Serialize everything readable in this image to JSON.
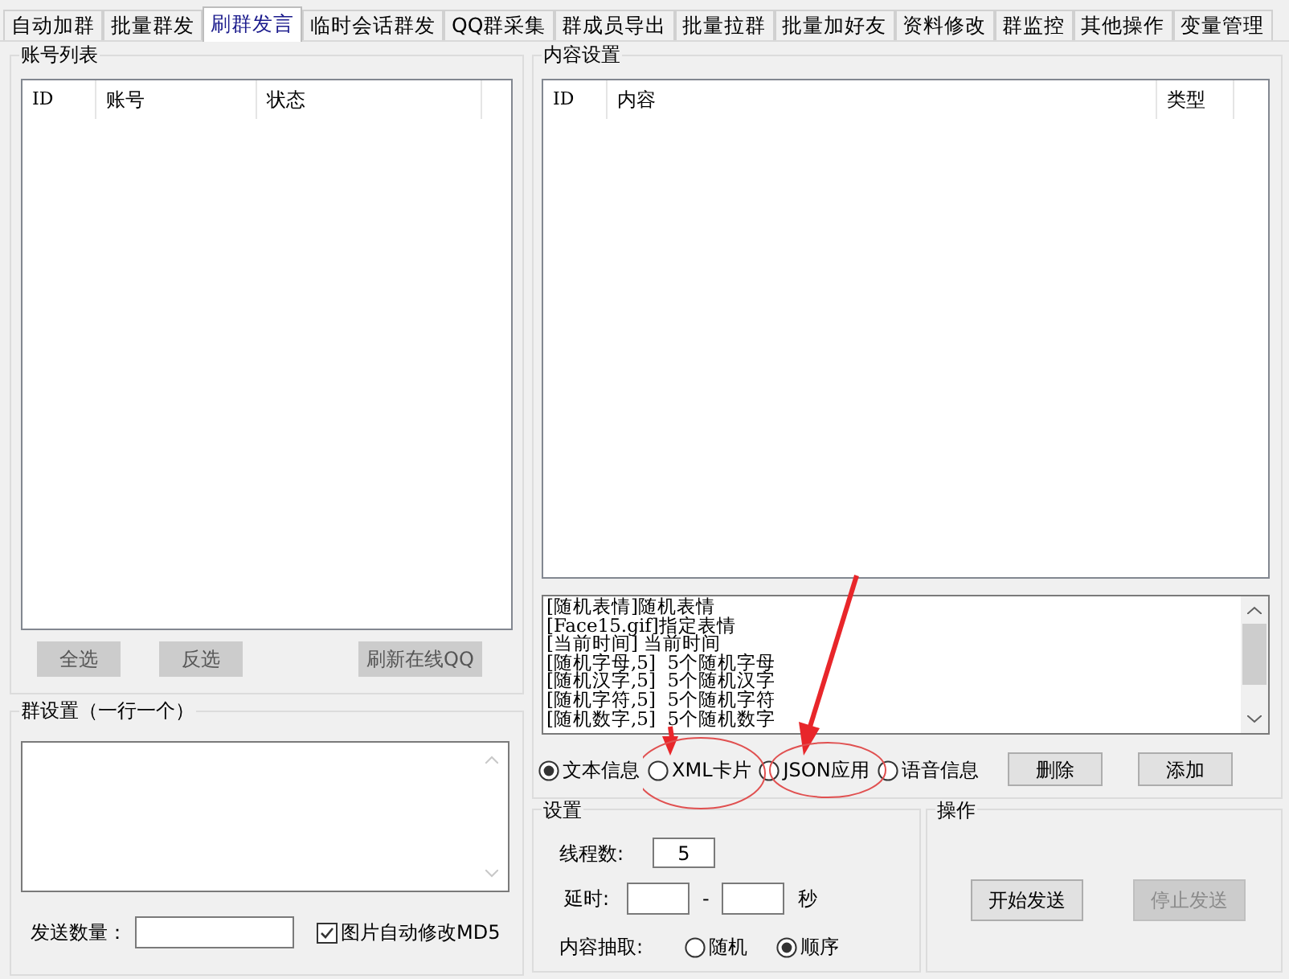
{
  "tabs": [
    {
      "label": "自动加群",
      "selected": false
    },
    {
      "label": "批量群发",
      "selected": false
    },
    {
      "label": "刷群发言",
      "selected": true
    },
    {
      "label": "临时会话群发",
      "selected": false
    },
    {
      "label": "QQ群采集",
      "selected": false
    },
    {
      "label": "群成员导出",
      "selected": false
    },
    {
      "label": "批量拉群",
      "selected": false
    },
    {
      "label": "批量加好友",
      "selected": false
    },
    {
      "label": "资料修改",
      "selected": false
    },
    {
      "label": "群监控",
      "selected": false
    },
    {
      "label": "其他操作",
      "selected": false
    },
    {
      "label": "变量管理",
      "selected": false
    }
  ],
  "account_list": {
    "title": "账号列表",
    "columns": [
      "ID",
      "账号",
      "状态"
    ],
    "buttons": [
      "全选",
      "反选",
      "刷新在线QQ"
    ]
  },
  "group_settings": {
    "title": "群设置（一行一个）",
    "send_count_label": "发送数量：",
    "auto_md5": {
      "label": "图片自动修改MD5",
      "checked": true
    }
  },
  "content_settings": {
    "title": "内容设置",
    "columns": [
      "ID",
      "内容",
      "类型"
    ],
    "variables": [
      "[随机表情]随机表情",
      "[Face15.gif]指定表情",
      "[当前时间] 当前时间",
      "[随机字母,5]  5个随机字母",
      "[随机汉字,5]  5个随机汉字",
      "[随机字符,5]  5个随机字符",
      "[随机数字,5]  5个随机数字"
    ],
    "message_types": [
      {
        "label": "文本信息",
        "selected": true
      },
      {
        "label": "XML卡片",
        "selected": false
      },
      {
        "label": "JSON应用",
        "selected": false
      },
      {
        "label": "语音信息",
        "selected": false
      }
    ],
    "buttons": [
      "删除",
      "添加"
    ]
  },
  "settings": {
    "title": "设置",
    "threads_label": "线程数:",
    "threads_value": "5",
    "delay_label": "延时:",
    "delay_separator": "-",
    "delay_unit": "秒",
    "extract_label": "内容抽取:",
    "extract_options": [
      {
        "label": "随机",
        "selected": false
      },
      {
        "label": "顺序",
        "selected": true
      }
    ]
  },
  "operations": {
    "title": "操作",
    "buttons": [
      {
        "label": "开始发送",
        "disabled": false
      },
      {
        "label": "停止发送",
        "disabled": true
      }
    ]
  }
}
